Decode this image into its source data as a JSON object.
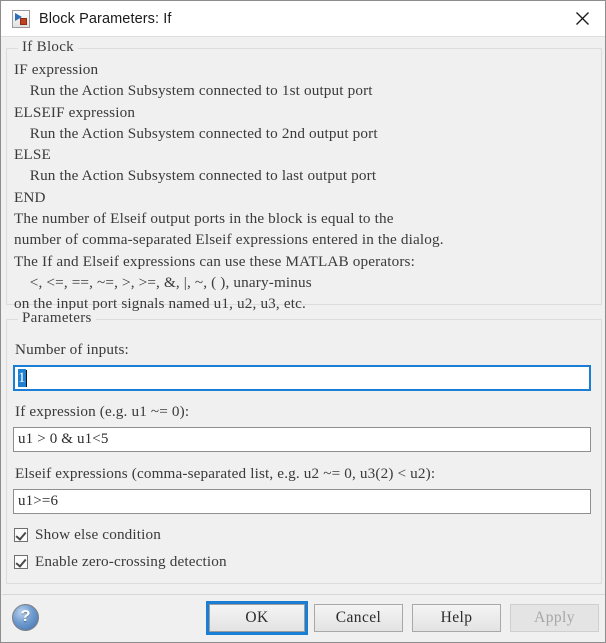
{
  "window": {
    "title": "Block Parameters: If",
    "icon": "simulink-block-icon",
    "close_label": "×"
  },
  "groups": {
    "if_block": {
      "legend": "If Block",
      "description": "IF expression\n    Run the Action Subsystem connected to 1st output port\nELSEIF expression\n    Run the Action Subsystem connected to 2nd output port\nELSE\n    Run the Action Subsystem connected to last output port\nEND\nThe number of Elseif output ports in the block is equal to the\nnumber of comma-separated Elseif expressions entered in the dialog.\nThe If and Elseif expressions can use these MATLAB operators:\n    <, <=, ==, ~=, >, >=, &, |, ~, ( ), unary-minus\non the input port signals named u1, u2, u3, etc."
    },
    "parameters": {
      "legend": "Parameters",
      "num_inputs": {
        "label": "Number of inputs:",
        "value": "1"
      },
      "if_expression": {
        "label": "If expression (e.g. u1 ~= 0):",
        "value": "u1 > 0 & u1<5"
      },
      "elseif_expressions": {
        "label": "Elseif expressions (comma-separated list, e.g. u2 ~= 0, u3(2) < u2):",
        "value": "u1>=6"
      },
      "show_else": {
        "label": "Show else condition",
        "checked": true
      },
      "zero_crossing": {
        "label": "Enable zero-crossing detection",
        "checked": true
      }
    }
  },
  "footer": {
    "help_icon": "question-mark-icon",
    "buttons": {
      "ok": "OK",
      "cancel": "Cancel",
      "help": "Help",
      "apply": "Apply"
    }
  },
  "colors": {
    "accent_blue": "#1a7fd4",
    "selection_blue": "#1f7fd0",
    "dialog_bg": "#f0f0f0",
    "text": "#3a3a3a"
  }
}
